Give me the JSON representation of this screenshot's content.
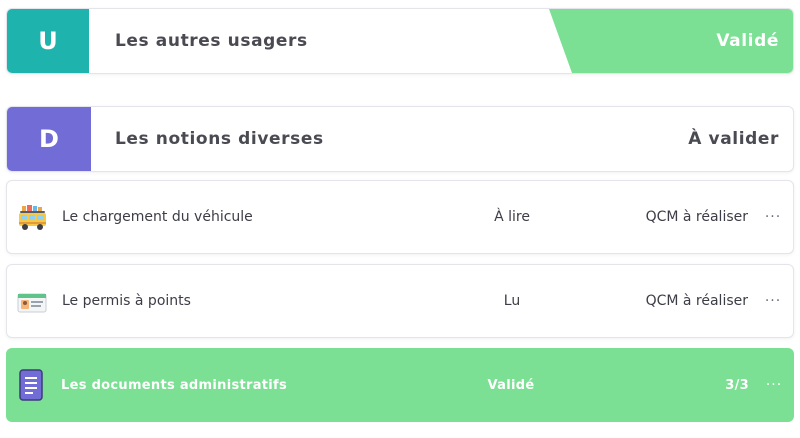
{
  "colors": {
    "accent_teal": "#1fb3ae",
    "accent_purple": "#716cd6",
    "valid_green": "#7be093"
  },
  "categories": [
    {
      "letter": "U",
      "title": "Les autres usagers",
      "status": "Validé"
    },
    {
      "letter": "D",
      "title": "Les notions diverses",
      "status": "À valider"
    }
  ],
  "lessons": [
    {
      "icon": "bus-loaded-icon",
      "title": "Le chargement du véhicule",
      "status": "À lire",
      "quiz": "QCM à réaliser",
      "more": "···"
    },
    {
      "icon": "id-card-icon",
      "title": "Le permis à points",
      "status": "Lu",
      "quiz": "QCM à réaliser",
      "more": "···"
    },
    {
      "icon": "document-icon",
      "title": "Les documents administratifs",
      "status": "Validé",
      "quiz": "3/3",
      "more": "···"
    }
  ]
}
